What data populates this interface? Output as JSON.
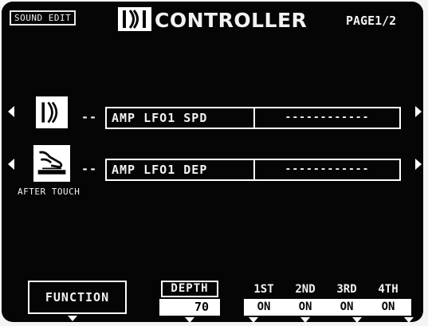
{
  "header": {
    "mode_tag": "SOUND EDIT",
    "title": "CONTROLLER",
    "page": "PAGE1/2",
    "icon": "controller-icon"
  },
  "controllers": [
    {
      "icon": "modulation-wheel-icon",
      "connector": "--",
      "parameter": "AMP LFO1 SPD",
      "value": "------------"
    },
    {
      "icon": "after-touch-icon",
      "icon_label": "AFTER TOUCH",
      "connector": "--",
      "parameter": "AMP LFO1 DEP",
      "value": "------------"
    }
  ],
  "footer": {
    "function_label": "FUNCTION",
    "depth": {
      "label": "DEPTH",
      "value": "70"
    },
    "stages": [
      {
        "label": "1ST",
        "value": "ON"
      },
      {
        "label": "2ND",
        "value": "ON"
      },
      {
        "label": "3RD",
        "value": "ON"
      },
      {
        "label": "4TH",
        "value": "ON"
      }
    ]
  },
  "colors": {
    "screen_background": "#050505",
    "foreground": "#ffffff"
  }
}
